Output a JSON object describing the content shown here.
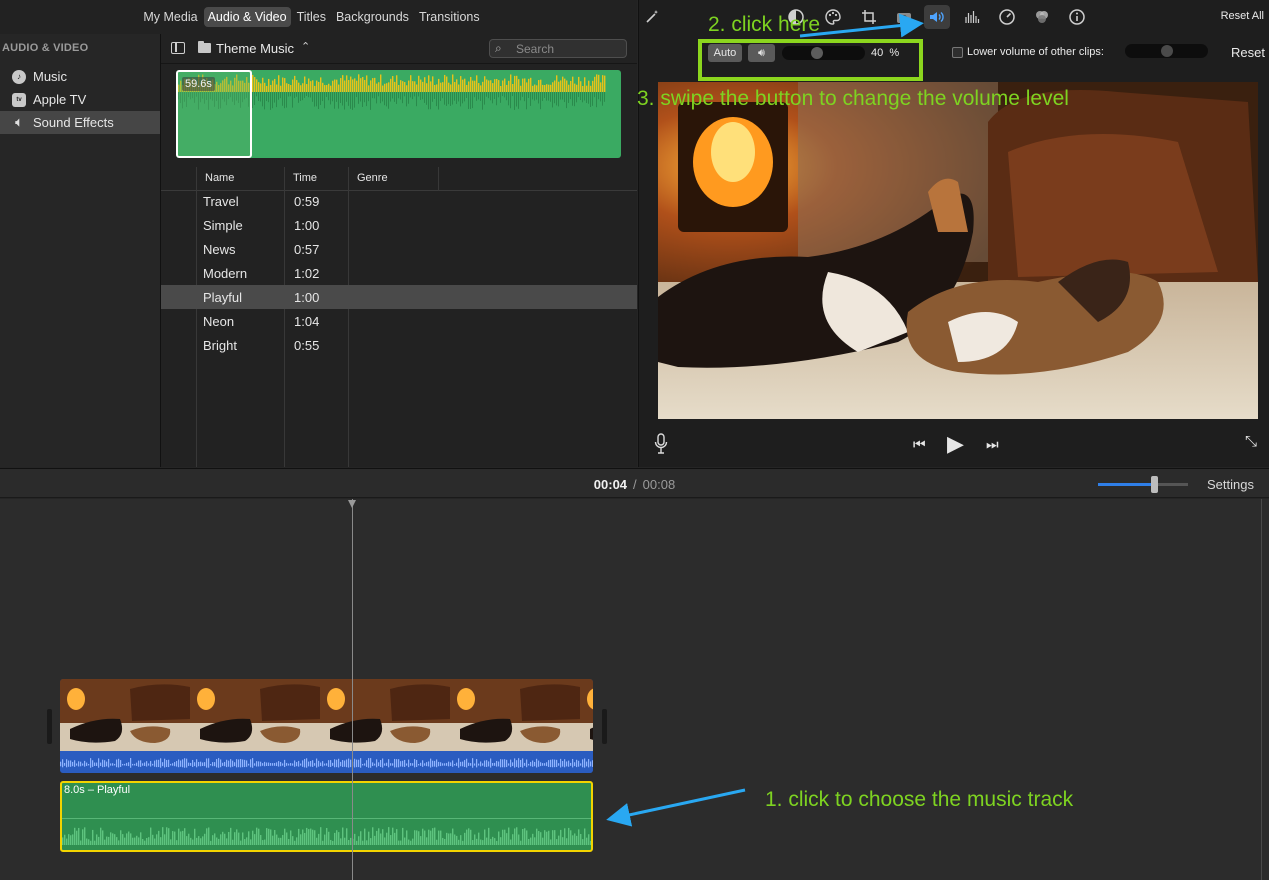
{
  "browser": {
    "tabs": [
      "My Media",
      "Audio & Video",
      "Titles",
      "Backgrounds",
      "Transitions"
    ],
    "active_tab": "Audio & Video",
    "sidebar_heading": "AUDIO & VIDEO",
    "sidebar_items": [
      {
        "label": "Music",
        "icon": "music-icon"
      },
      {
        "label": "Apple TV",
        "icon": "appletv-icon"
      },
      {
        "label": "Sound Effects",
        "icon": "speaker-icon"
      }
    ],
    "selected_sidebar": "Sound Effects",
    "folder": "Theme Music",
    "search_placeholder": "Search",
    "preview_duration": "59.6s",
    "columns": [
      "Name",
      "Time",
      "Genre"
    ],
    "rows": [
      {
        "name": "Travel",
        "time": "0:59",
        "genre": ""
      },
      {
        "name": "Simple",
        "time": "1:00",
        "genre": ""
      },
      {
        "name": "News",
        "time": "0:57",
        "genre": ""
      },
      {
        "name": "Modern",
        "time": "1:02",
        "genre": ""
      },
      {
        "name": "Playful",
        "time": "1:00",
        "genre": ""
      },
      {
        "name": "Neon",
        "time": "1:04",
        "genre": ""
      },
      {
        "name": "Bright",
        "time": "0:55",
        "genre": ""
      }
    ],
    "selected_row": "Playful"
  },
  "viewer": {
    "tools": [
      "magic-wand-icon",
      "color-balance-icon",
      "color-palette-icon",
      "crop-icon",
      "stabilization-icon",
      "volume-icon",
      "noise-reduction-icon",
      "speed-icon",
      "filters-icon",
      "info-icon"
    ],
    "active_tool": "volume-icon",
    "reset_all": "Reset All",
    "auto_label": "Auto",
    "volume_percent": "40",
    "volume_unit": "%",
    "volume_level": 0.4,
    "lower_label": "Lower volume of other clips:",
    "lower_checked": false,
    "lower_level": 0.5,
    "reset_label": "Reset"
  },
  "timeline": {
    "current_time": "00:04",
    "separator": "/",
    "total_time": "00:08",
    "settings_label": "Settings",
    "zoom_level": 0.62,
    "music_clip_label": "8.0s – Playful"
  },
  "annotations": {
    "step1": "1. click to choose the music track",
    "step2": "2. click here",
    "step3": "3. swipe the button to change the volume level",
    "color": "#7ed321",
    "arrow_color": "#29a8f2"
  },
  "colors": {
    "accent_blue": "#2f7fe8",
    "selection_yellow": "#f3d400",
    "audio_green": "#3aaa62"
  }
}
